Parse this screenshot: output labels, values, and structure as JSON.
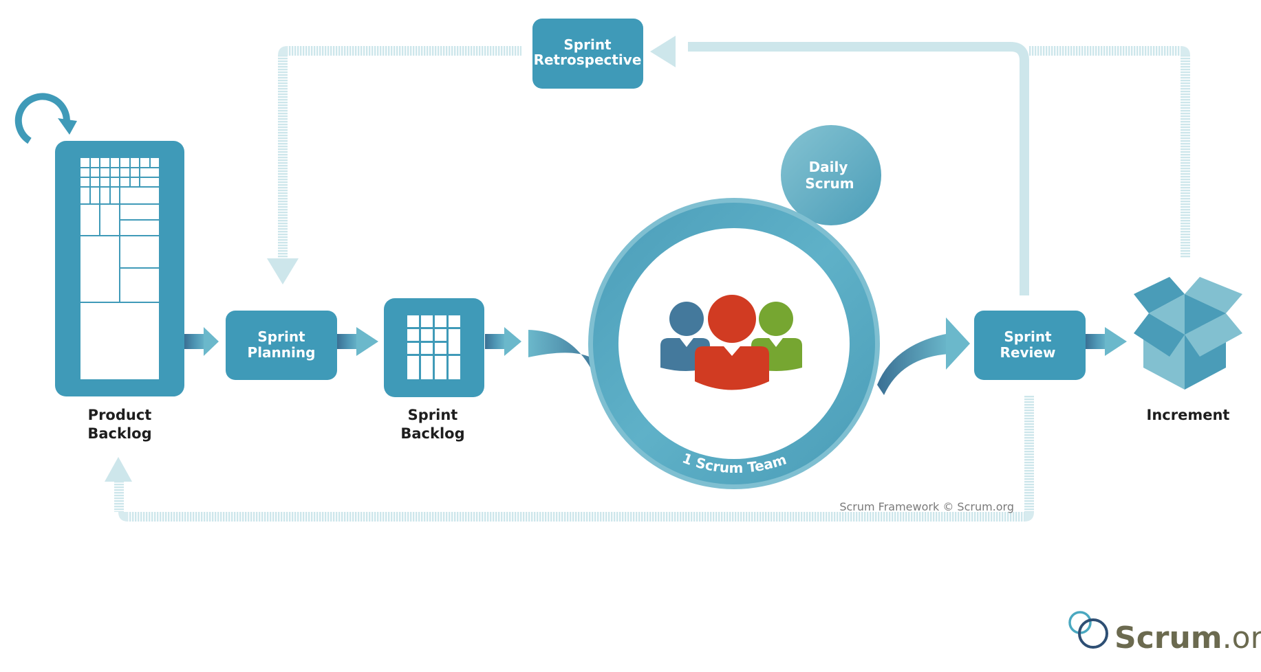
{
  "diagram": {
    "title": "Scrum Framework",
    "colors": {
      "primary": "#3f9ab8",
      "light_flow": "#cde6eb",
      "ring": "#52a7c0",
      "ring_light": "#7fbfd1",
      "person_blue": "#44799c",
      "person_red": "#d13b22",
      "person_green": "#76a631",
      "box_dark": "#4a9cb8",
      "box_light": "#82c0d0",
      "logo_text": "#6b6a4f"
    },
    "nodes": {
      "product_backlog": {
        "caption_line1": "Product",
        "caption_line2": "Backlog"
      },
      "sprint_planning": {
        "line1": "Sprint",
        "line2": "Planning"
      },
      "sprint_backlog": {
        "caption_line1": "Sprint",
        "caption_line2": "Backlog"
      },
      "scrum_team": {
        "label": "1 Scrum Team"
      },
      "daily_scrum": {
        "line1": "Daily",
        "line2": "Scrum"
      },
      "sprint_review": {
        "line1": "Sprint",
        "line2": "Review"
      },
      "increment": {
        "caption": "Increment"
      },
      "sprint_retrospective": {
        "line1": "Sprint",
        "line2": "Retrospective"
      }
    },
    "copyright": "Scrum Framework © Scrum.org",
    "logo": {
      "word_main": "Scrum",
      "word_suffix": ".org"
    }
  }
}
